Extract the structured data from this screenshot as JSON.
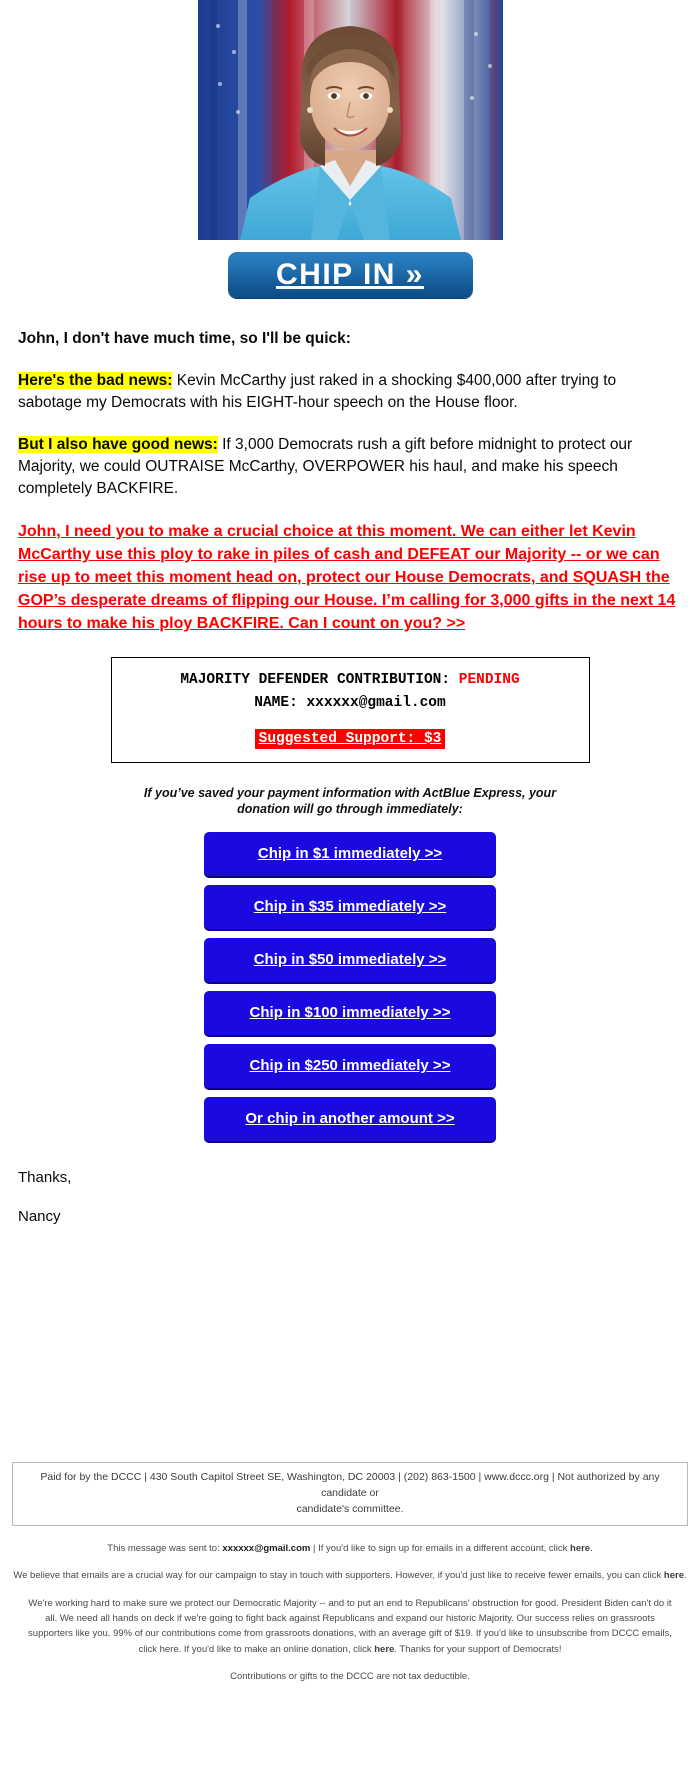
{
  "hero": {
    "alt": "nancy-pelosi-portrait-with-american-flags"
  },
  "cta": {
    "chip_in_label": "CHIP IN »"
  },
  "body": {
    "salutation": "John, I don't have much time, so I'll be quick:",
    "bad_news_label": "Here's the bad news:",
    "bad_news_text": " Kevin McCarthy just raked in a shocking $400,000 after trying to sabotage my Democrats with his EIGHT-hour speech on the House floor.",
    "good_news_label": "But I also have good news:",
    "good_news_text": " If 3,000 Democrats rush a gift before midnight to protect our Majority, we could OUTRAISE McCarthy, OVERPOWER his haul, and make his speech completely BACKFIRE.",
    "red_cta": "John, I need you to make a crucial choice at this moment. We can either let Kevin McCarthy use this ploy to rake in piles of cash and DEFEAT our Majority -- or we can rise up to meet this moment head on, protect our House Democrats, and SQUASH the GOP’s desperate dreams of flipping our House. I’m calling for 3,000 gifts in the next 14 hours to make his ploy BACKFIRE. Can I count on you? >>"
  },
  "status_box": {
    "contribution_label": "MAJORITY DEFENDER CONTRIBUTION:",
    "contribution_status": "PENDING",
    "name_label": "NAME:",
    "name_value": "xxxxxx@gmail.com",
    "suggested_support": "Suggested Support: $3"
  },
  "actblue_note": "If you’ve saved your payment information with ActBlue Express, your donation will go through immediately:",
  "donate_buttons": [
    {
      "label": "Chip in $1 immediately >>"
    },
    {
      "label": "Chip in $35 immediately >>"
    },
    {
      "label": "Chip in $50 immediately >>"
    },
    {
      "label": "Chip in $100 immediately >>"
    },
    {
      "label": "Chip in $250 immediately >>"
    },
    {
      "label": "Or chip in another amount >>"
    }
  ],
  "signoff": {
    "thanks": "Thanks,",
    "name": "Nancy"
  },
  "footer": {
    "paid_for_line1": "Paid for by the DCCC | 430 South Capitol Street SE, Washington, DC 20003 | (202) 863-1500 | www.dccc.org | Not authorized by any candidate or",
    "paid_for_line2": "candidate's committee.",
    "sent_to_prefix": "This message was sent to: ",
    "sent_to_email": "xxxxxx@gmail.com",
    "sent_to_suffix": " | If you'd like to sign up for emails in a different account, click ",
    "sent_to_link": "here",
    "sent_to_end": ".",
    "fewer_emails_prefix": "We believe that emails are a crucial way for our campaign to stay in touch with supporters. However, if you'd just like to receive fewer emails, you can click ",
    "fewer_emails_link": "here",
    "fewer_emails_end": ".",
    "long_block_a": "We're working hard to make sure we protect our Democratic Majority -- and to put an end to Republicans' obstruction for good. President Biden can't do it all. We need all hands on deck if we're going to fight back against Republicans and expand our historic Majority. Our success relies on grassroots supporters like you. 99% of our contributions come from grassroots donations, with an average gift of $19. If you'd like to unsubscribe from DCCC emails, click here. If you'd like to make an online donation, click ",
    "long_block_link": "here",
    "long_block_b": ". Thanks for your support of Democrats!",
    "tax_line": "Contributions or gifts to the DCCC are not tax deductible."
  },
  "colors": {
    "highlight": "#ffff00",
    "red": "#ff0000",
    "donate_blue": "#1a0ae0",
    "chipin_blue": "#1f6fb0"
  }
}
